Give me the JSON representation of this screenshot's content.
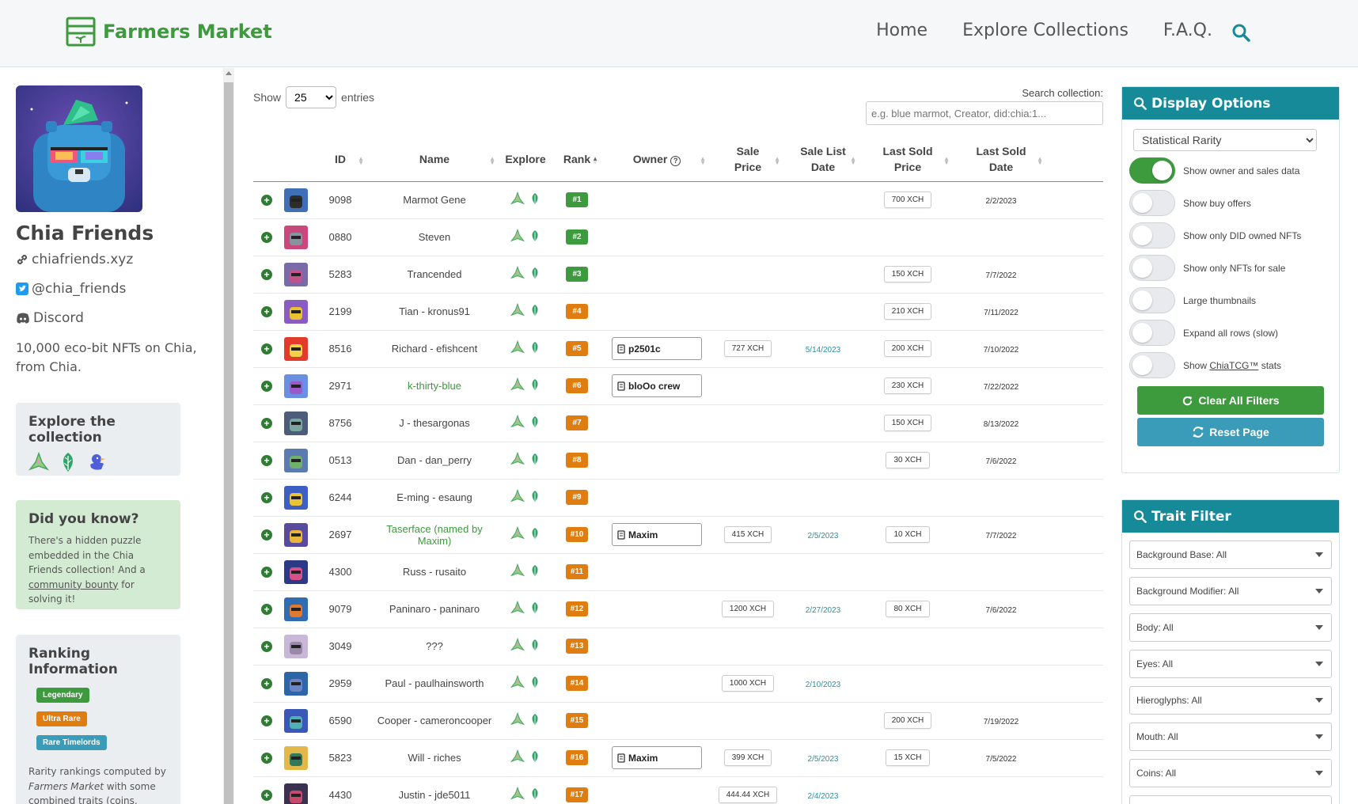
{
  "header": {
    "logo_text": "Farmers Market",
    "nav": [
      {
        "label": "Home"
      },
      {
        "label": "Explore Collections"
      },
      {
        "label": "F.A.Q."
      }
    ]
  },
  "sidebar": {
    "collection_title": "Chia Friends",
    "website": "chiafriends.xyz",
    "twitter": "@chia_friends",
    "discord": "Discord",
    "description": "10,000 eco-bit NFTs on Chia, from Chia.",
    "explore": {
      "title": "Explore the collection"
    },
    "did_you_know": {
      "title": "Did you know?",
      "text_1": "There's a hidden puzzle embedded in the Chia Friends collection! And a ",
      "link": "community bounty",
      "text_2": " for solving it!"
    },
    "ranking": {
      "title": "Ranking Information",
      "tags": [
        {
          "label": "Legendary",
          "color": "#3d9a3d"
        },
        {
          "label": "Ultra Rare",
          "color": "#e07d10"
        },
        {
          "label": "Rare Timelords",
          "color": "#3a9cb8"
        }
      ],
      "text_1": "Rarity rankings computed by ",
      "text_em": "Farmers Market",
      "text_2": " with some combined traits (coins, keywords, artifacts) and some"
    }
  },
  "controls": {
    "show_label": "Show",
    "entries_value": "25",
    "entries_label": "entries",
    "search_label": "Search collection:",
    "search_placeholder": "e.g. blue marmot, Creator, did:chia:1..."
  },
  "table": {
    "headers": {
      "id": "ID",
      "name": "Name",
      "explore": "Explore",
      "rank": "Rank",
      "owner": "Owner",
      "sale_price_1": "Sale",
      "sale_price_2": "Price",
      "sale_list_1": "Sale List",
      "sale_list_2": "Date",
      "last_price_1": "Last Sold",
      "last_price_2": "Price",
      "last_date_1": "Last Sold",
      "last_date_2": "Date"
    },
    "rows": [
      {
        "id": "9098",
        "name": "Marmot Gene",
        "rank": "#1",
        "rank_color": "#3d9a3d",
        "owner": "",
        "sale_price": "",
        "sale_date": "",
        "last_price": "700 XCH",
        "last_date": "2/2/2023",
        "thumb_bg": "#3f6fb5",
        "thumb_face": "#2d2d2d",
        "name_link": false
      },
      {
        "id": "0880",
        "name": "Steven",
        "rank": "#2",
        "rank_color": "#3d9a3d",
        "owner": "",
        "sale_price": "",
        "sale_date": "",
        "last_price": "",
        "last_date": "",
        "thumb_bg": "#c8497c",
        "thumb_face": "#8892a0",
        "name_link": false
      },
      {
        "id": "5283",
        "name": "Trancended",
        "rank": "#3",
        "rank_color": "#3d9a3d",
        "owner": "",
        "sale_price": "",
        "sale_date": "",
        "last_price": "150 XCH",
        "last_date": "7/7/2022",
        "thumb_bg": "#7a6aa8",
        "thumb_face": "#c1538a",
        "name_link": false
      },
      {
        "id": "2199",
        "name": "Tian - kronus91",
        "rank": "#4",
        "rank_color": "#e07d10",
        "owner": "",
        "sale_price": "",
        "sale_date": "",
        "last_price": "210 XCH",
        "last_date": "7/11/2022",
        "thumb_bg": "#8a5cc2",
        "thumb_face": "#e8c230",
        "name_link": false
      },
      {
        "id": "8516",
        "name": "Richard - efishcent",
        "rank": "#5",
        "rank_color": "#e07d10",
        "owner": "p2501c",
        "sale_price": "727 XCH",
        "sale_date": "5/14/2023",
        "last_price": "200 XCH",
        "last_date": "7/10/2022",
        "thumb_bg": "#e23b2e",
        "thumb_face": "#f1d04a",
        "name_link": false
      },
      {
        "id": "2971",
        "name": "k-thirty-blue",
        "rank": "#6",
        "rank_color": "#e07d10",
        "owner": "bloOo crew",
        "sale_price": "",
        "sale_date": "",
        "last_price": "230 XCH",
        "last_date": "7/22/2022",
        "thumb_bg": "#6a8fe0",
        "thumb_face": "#9b59c9",
        "name_link": true
      },
      {
        "id": "8756",
        "name": "J - thesargonas",
        "rank": "#7",
        "rank_color": "#e07d10",
        "owner": "",
        "sale_price": "",
        "sale_date": "",
        "last_price": "150 XCH",
        "last_date": "8/13/2022",
        "thumb_bg": "#4c5c7a",
        "thumb_face": "#7aa6a0",
        "name_link": false
      },
      {
        "id": "0513",
        "name": "Dan - dan_perry",
        "rank": "#8",
        "rank_color": "#e07d10",
        "owner": "",
        "sale_price": "",
        "sale_date": "",
        "last_price": "30 XCH",
        "last_date": "7/6/2022",
        "thumb_bg": "#5a7ab0",
        "thumb_face": "#6fb06a",
        "name_link": false
      },
      {
        "id": "6244",
        "name": "E-ming - esaung",
        "rank": "#9",
        "rank_color": "#e07d10",
        "owner": "",
        "sale_price": "",
        "sale_date": "",
        "last_price": "",
        "last_date": "",
        "thumb_bg": "#3d5fc2",
        "thumb_face": "#e9c43a",
        "name_link": false
      },
      {
        "id": "2697",
        "name": "Taserface (named by Maxim)",
        "rank": "#10",
        "rank_color": "#e07d10",
        "owner": "Maxim",
        "sale_price": "415 XCH",
        "sale_date": "2/5/2023",
        "last_price": "10 XCH",
        "last_date": "7/7/2022",
        "thumb_bg": "#5a4a9e",
        "thumb_face": "#e8b43a",
        "name_link": true
      },
      {
        "id": "4300",
        "name": "Russ - rusaito",
        "rank": "#11",
        "rank_color": "#e07d10",
        "owner": "",
        "sale_price": "",
        "sale_date": "",
        "last_price": "",
        "last_date": "",
        "thumb_bg": "#2c3a86",
        "thumb_face": "#d6508a",
        "name_link": false
      },
      {
        "id": "9079",
        "name": "Paninaro - paninaro",
        "rank": "#12",
        "rank_color": "#e07d10",
        "owner": "",
        "sale_price": "1200 XCH",
        "sale_date": "2/27/2023",
        "last_price": "80 XCH",
        "last_date": "7/6/2022",
        "thumb_bg": "#2f6db0",
        "thumb_face": "#e07a2e",
        "name_link": false
      },
      {
        "id": "3049",
        "name": "???",
        "rank": "#13",
        "rank_color": "#e07d10",
        "owner": "",
        "sale_price": "",
        "sale_date": "",
        "last_price": "",
        "last_date": "",
        "thumb_bg": "#c9b7d8",
        "thumb_face": "#9a8aa8",
        "name_link": false
      },
      {
        "id": "2959",
        "name": "Paul - paulhainsworth",
        "rank": "#14",
        "rank_color": "#e07d10",
        "owner": "",
        "sale_price": "1000 XCH",
        "sale_date": "2/10/2023",
        "last_price": "",
        "last_date": "",
        "thumb_bg": "#2d66a8",
        "thumb_face": "#6b86c0",
        "name_link": false
      },
      {
        "id": "6590",
        "name": "Cooper - cameroncooper",
        "rank": "#15",
        "rank_color": "#e07d10",
        "owner": "",
        "sale_price": "",
        "sale_date": "",
        "last_price": "200 XCH",
        "last_date": "7/19/2022",
        "thumb_bg": "#3a58b8",
        "thumb_face": "#4fb0b5",
        "name_link": false
      },
      {
        "id": "5823",
        "name": "Will - riches",
        "rank": "#16",
        "rank_color": "#e07d10",
        "owner": "Maxim",
        "sale_price": "399 XCH",
        "sale_date": "2/5/2023",
        "last_price": "15 XCH",
        "last_date": "7/5/2022",
        "thumb_bg": "#e3b84a",
        "thumb_face": "#2f7a5a",
        "name_link": false
      },
      {
        "id": "4430",
        "name": "Justin - jde5011",
        "rank": "#17",
        "rank_color": "#e07d10",
        "owner": "",
        "sale_price": "444.44 XCH",
        "sale_date": "2/4/2023",
        "last_price": "",
        "last_date": "",
        "thumb_bg": "#3a3050",
        "thumb_face": "#c84a6a",
        "name_link": false
      }
    ]
  },
  "display_options": {
    "title": "Display Options",
    "rarity_value": "Statistical Rarity",
    "toggles": [
      {
        "label": "Show owner and sales data",
        "on": true
      },
      {
        "label": "Show buy offers",
        "on": false
      },
      {
        "label": "Show only DID owned NFTs",
        "on": false
      },
      {
        "label": "Show only NFTs for sale",
        "on": false
      },
      {
        "label": "Large thumbnails",
        "on": false
      },
      {
        "label": "Expand all rows (slow)",
        "on": false
      }
    ],
    "tcg_prefix": "Show ",
    "tcg_link": "ChiaTCG™",
    "tcg_suffix": " stats",
    "clear_label": "Clear All Filters",
    "reset_label": "Reset Page"
  },
  "trait_filter": {
    "title": "Trait Filter",
    "filters": [
      "Background Base: All",
      "Background Modifier: All",
      "Body: All",
      "Eyes: All",
      "Hieroglyphs: All",
      "Mouth: All",
      "Coins: All"
    ]
  },
  "colors": {
    "brand_green": "#3d9a3d",
    "teal": "#178a9a",
    "orange": "#e07d10"
  }
}
